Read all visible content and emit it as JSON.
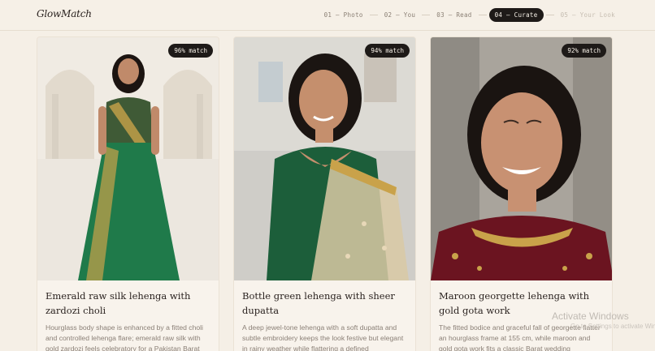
{
  "brand": "GlowMatch",
  "steps": [
    {
      "label": "01 — Photo",
      "state": "done"
    },
    {
      "label": "02 — You",
      "state": "done"
    },
    {
      "label": "03 — Read",
      "state": "done"
    },
    {
      "label": "04 — Curate",
      "state": "active"
    },
    {
      "label": "05 — Your Look",
      "state": "future"
    }
  ],
  "cards": [
    {
      "badge": "96% match",
      "title": "Emerald raw silk lehenga with zardozi choli",
      "desc": "Hourglass body shape is enhanced by a fitted choli and controlled lehenga flare; emerald raw silk with gold zardozi feels celebratory for a Pakistan Barat",
      "photo": "woman-in-emerald-lehenga"
    },
    {
      "badge": "94% match",
      "title": "Bottle green lehenga with sheer dupatta",
      "desc": "A deep jewel-tone lehenga with a soft dupatta and subtle embroidery keeps the look festive but elegant in rainy weather while flattering a defined",
      "photo": "woman-in-bottle-green-lehenga"
    },
    {
      "badge": "92% match",
      "title": "Maroon georgette lehenga with gold gota work",
      "desc": "The fitted bodice and graceful fall of georgette flatter an hourglass frame at 155 cm, while maroon and gold gota work fits a classic Barat wedding",
      "photo": "woman-in-maroon-lehenga"
    }
  ],
  "watermark": {
    "title": "Activate Windows",
    "sub": "Go to Settings to activate Windows."
  },
  "colors": {
    "background": "#f5efe6",
    "active_step": "#1e1a18",
    "emerald": "#1f7a4a",
    "bottle_green": "#1c5e3a",
    "maroon": "#6b1420",
    "gold": "#c9a24a"
  }
}
